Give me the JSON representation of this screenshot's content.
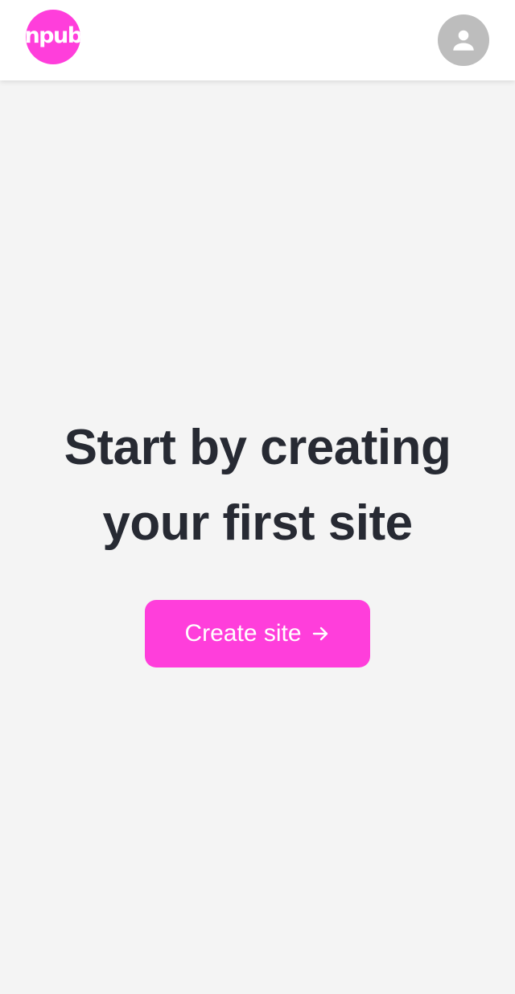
{
  "brand": {
    "logo_text": "npub",
    "color": "#ff3edb"
  },
  "header": {
    "avatar_icon": "user-avatar-icon",
    "avatar_color": "#bdbdbd"
  },
  "main": {
    "headline_line1": "Start by creating",
    "headline_line2": "your first site",
    "cta_label": "Create site",
    "cta_icon": "arrow-right-icon"
  }
}
